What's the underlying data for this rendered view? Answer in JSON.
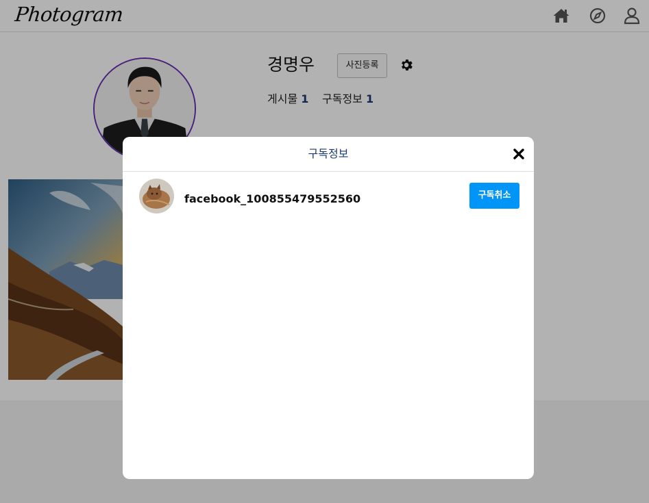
{
  "header": {
    "logo": "Photogram",
    "icons": [
      "home-icon",
      "compass-icon",
      "user-icon"
    ]
  },
  "profile": {
    "name": "경명우",
    "upload_button": "사진등록",
    "stats": {
      "posts_label": "게시물",
      "posts_count": "1",
      "subscriptions_label": "구독정보",
      "subscriptions_count": "1"
    }
  },
  "modal": {
    "title": "구독정보",
    "close_icon": "close-icon",
    "subscriptions": [
      {
        "username": "facebook_100855479552560",
        "button_label": "구독취소"
      }
    ]
  },
  "colors": {
    "accent_blue": "#0095f6",
    "title_navy": "#1b3b6f",
    "avatar_ring": "#6a2fb3"
  }
}
